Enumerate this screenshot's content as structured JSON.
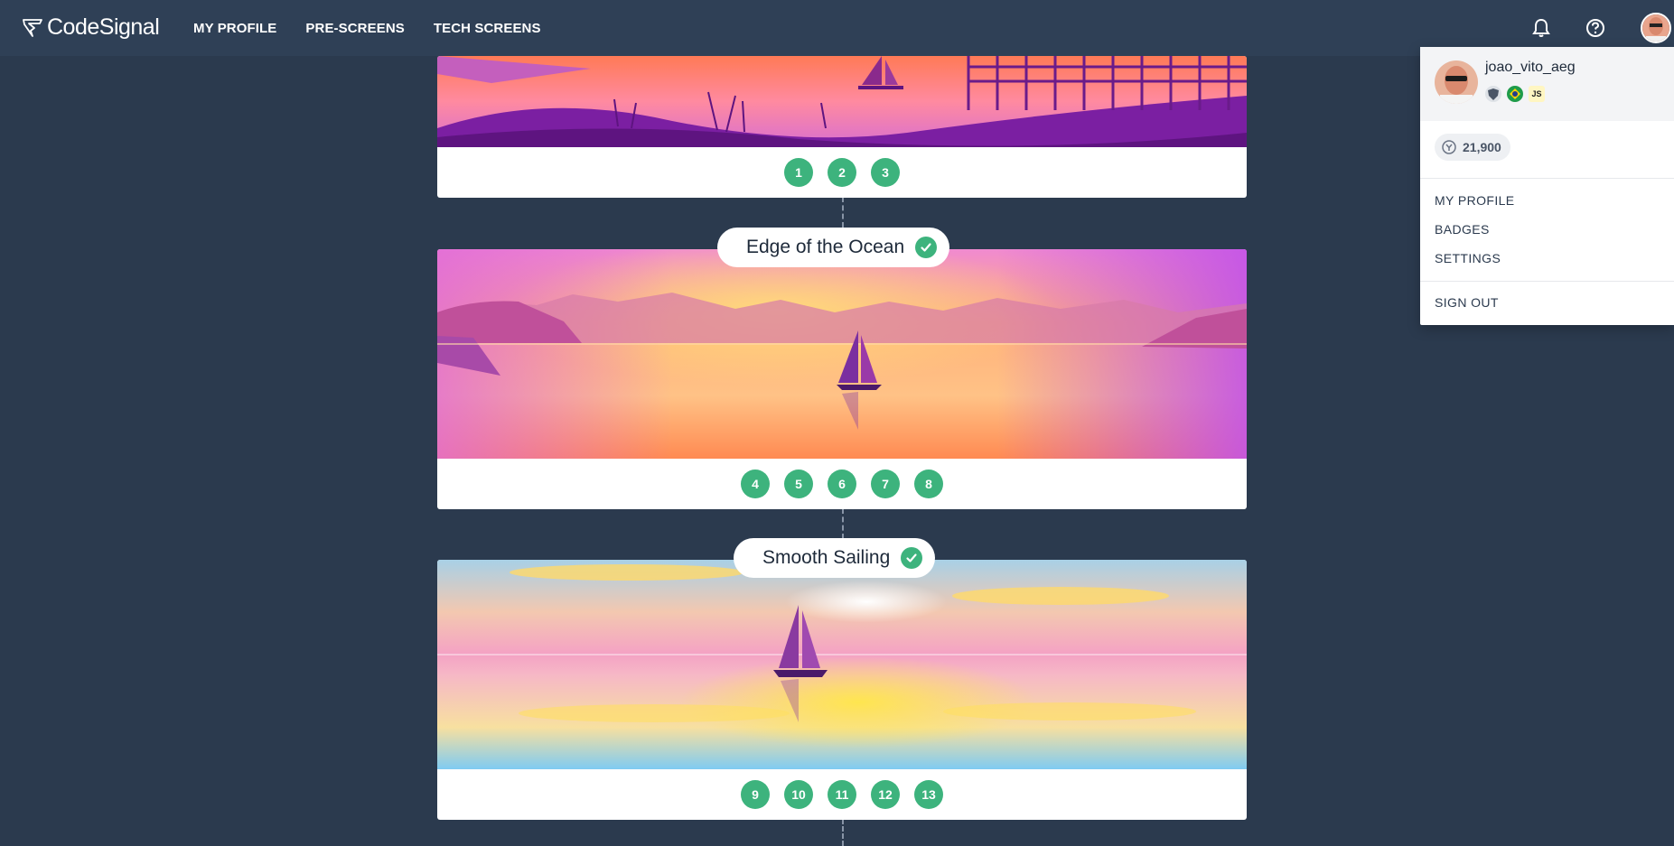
{
  "header": {
    "logo_text": "CodeSignal",
    "nav": [
      {
        "label": "MY PROFILE"
      },
      {
        "label": "PRE-SCREENS"
      },
      {
        "label": "TECH SCREENS"
      }
    ],
    "icons": [
      "bell-icon",
      "help-icon",
      "avatar"
    ]
  },
  "timeline": {
    "top_card": {
      "levels": [
        "1",
        "2",
        "3"
      ]
    },
    "sections": [
      {
        "title": "Edge of the Ocean",
        "completed": true,
        "levels": [
          "4",
          "5",
          "6",
          "7",
          "8"
        ]
      },
      {
        "title": "Smooth Sailing",
        "completed": true,
        "levels": [
          "9",
          "10",
          "11",
          "12",
          "13"
        ]
      }
    ]
  },
  "dropdown": {
    "username": "joao_vito_aeg",
    "badges": [
      "shield-badge-icon",
      "brazil-flag-icon",
      "JS"
    ],
    "coins": "21,900",
    "menu": {
      "profile": "MY PROFILE",
      "badges": "BADGES",
      "settings": "SETTINGS",
      "signout": "SIGN OUT"
    }
  },
  "colors": {
    "background": "#2b3a4e",
    "header": "#2f4056",
    "accent_green": "#3db37d"
  }
}
